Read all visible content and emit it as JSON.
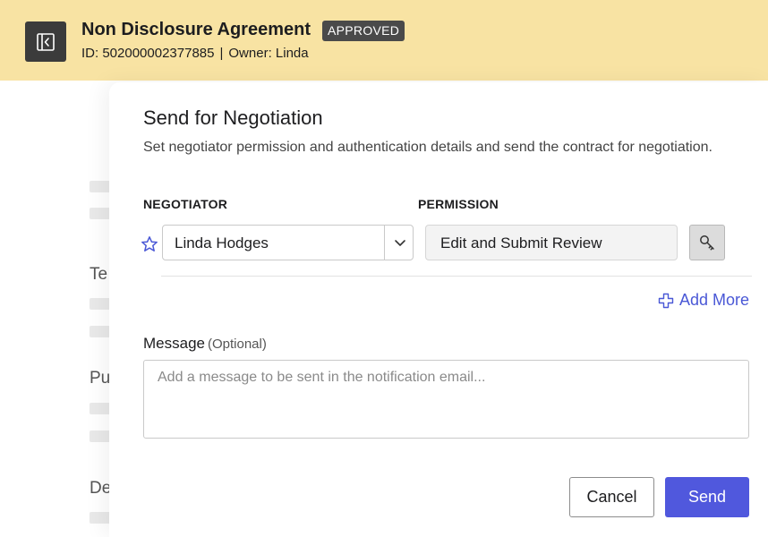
{
  "header": {
    "back_icon": "collapse-left-icon",
    "title": "Non Disclosure Agreement",
    "status": "APPROVED",
    "id_text": "ID: 502000002377885",
    "owner_text": "Owner: Linda",
    "separator": "|",
    "background_color": "#f8e3a3"
  },
  "background_page": {
    "labels": [
      "Te",
      "Pu",
      "De"
    ]
  },
  "panel": {
    "title": "Send for Negotiation",
    "description": "Set negotiator permission and authentication details and send the contract for negotiation.",
    "columns": {
      "negotiator_label": "NEGOTIATOR",
      "permission_label": "PERMISSION"
    },
    "negotiator": {
      "icon": "star-icon",
      "value": "Linda Hodges"
    },
    "permission": {
      "value": "Edit and Submit Review",
      "auth_icon": "key-icon"
    },
    "add_more_label": "Add More",
    "message": {
      "label": "Message",
      "optional": "(Optional)",
      "placeholder": "Add a message to be sent in the notification email..."
    },
    "buttons": {
      "cancel": "Cancel",
      "send": "Send"
    },
    "accent_color": "#5058dd"
  }
}
